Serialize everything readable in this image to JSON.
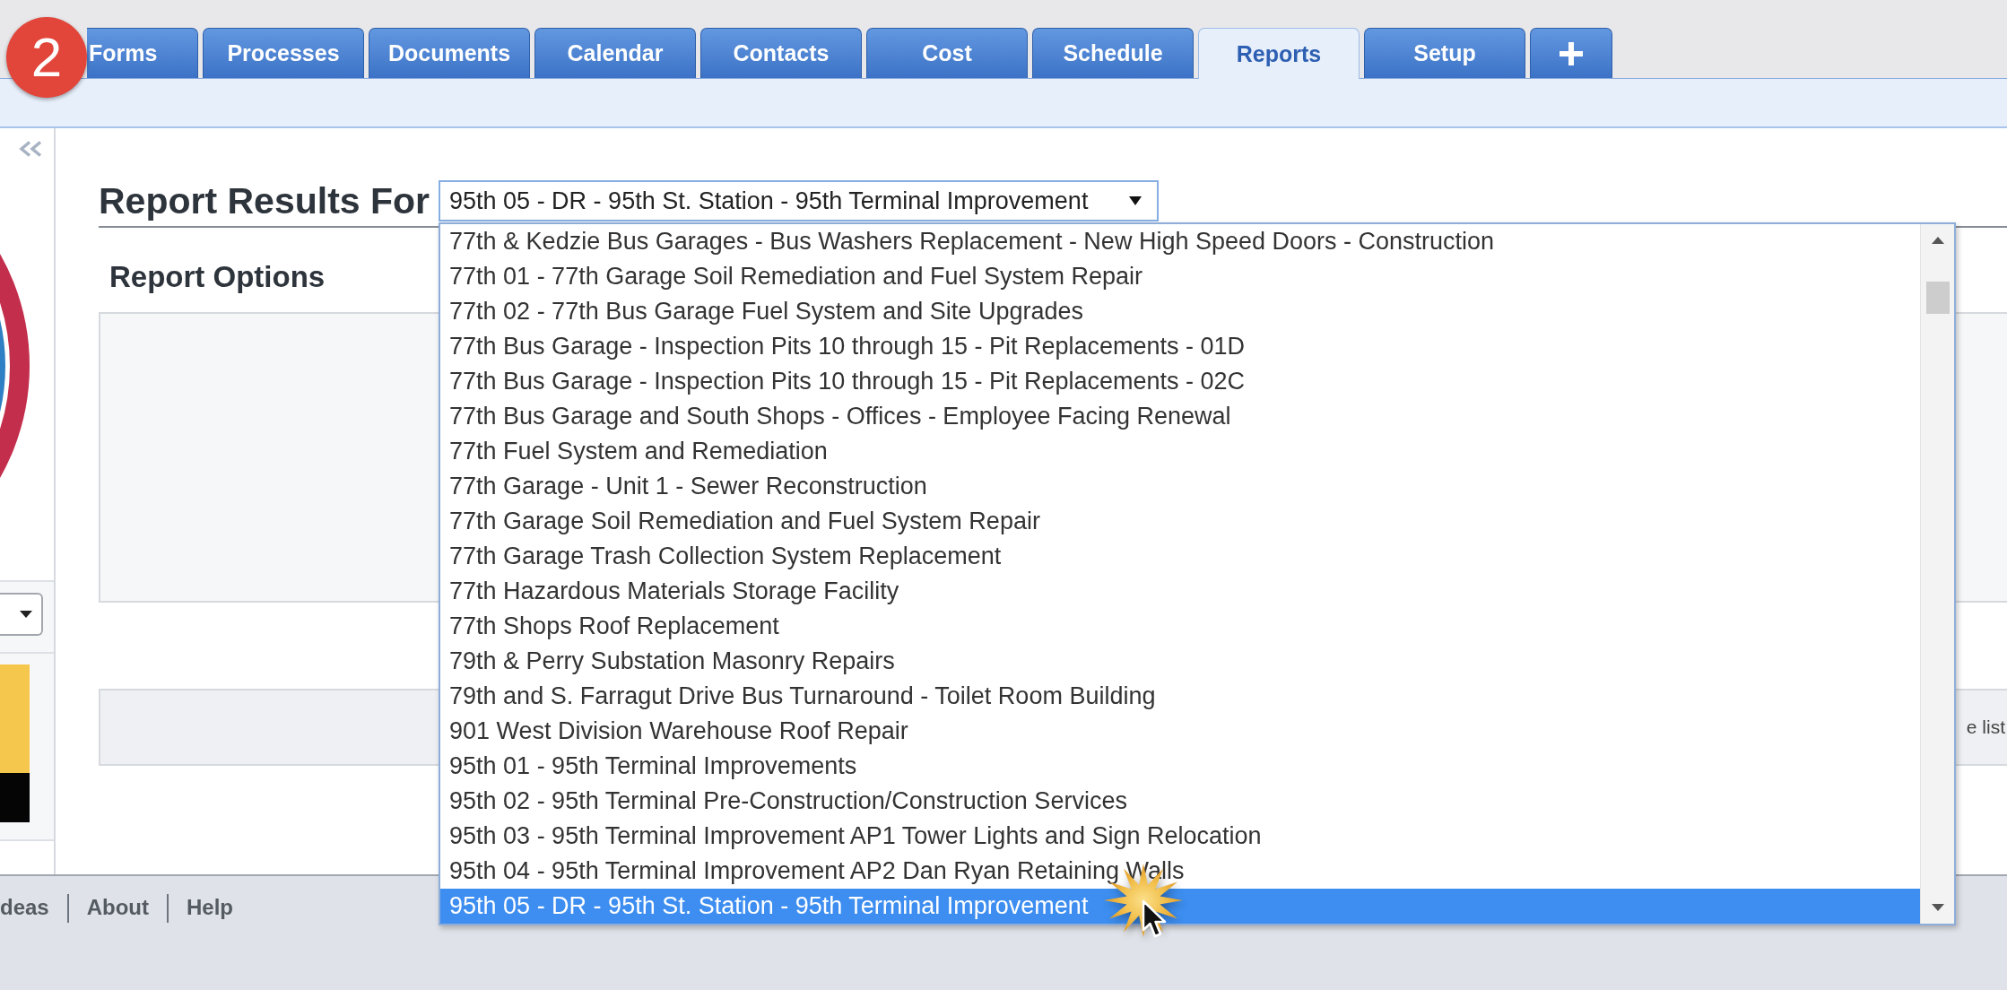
{
  "badge": "2",
  "tabs": [
    {
      "label": "Forms",
      "selected": false
    },
    {
      "label": "Processes",
      "selected": false
    },
    {
      "label": "Documents",
      "selected": false
    },
    {
      "label": "Calendar",
      "selected": false
    },
    {
      "label": "Contacts",
      "selected": false
    },
    {
      "label": "Cost",
      "selected": false
    },
    {
      "label": "Schedule",
      "selected": false
    },
    {
      "label": "Reports",
      "selected": true
    },
    {
      "label": "Setup",
      "selected": false
    }
  ],
  "report": {
    "heading": "Report Results For",
    "project_select": {
      "value": "95th 05 - DR - 95th St. Station - 95th Terminal Improvement",
      "expanded": true
    },
    "options_heading": "Report Options",
    "bar_text": "e list"
  },
  "dropdown_options": [
    {
      "label": "77th & Kedzie Bus Garages - Bus Washers Replacement - New High Speed Doors - Construction",
      "selected": false
    },
    {
      "label": "77th 01 - 77th Garage Soil Remediation and Fuel System Repair",
      "selected": false
    },
    {
      "label": "77th 02 - 77th Bus Garage Fuel System and Site Upgrades",
      "selected": false
    },
    {
      "label": "77th Bus Garage - Inspection Pits 10 through 15 - Pit Replacements - 01D",
      "selected": false
    },
    {
      "label": "77th Bus Garage - Inspection Pits 10 through 15 - Pit Replacements - 02C",
      "selected": false
    },
    {
      "label": "77th Bus Garage and South Shops - Offices - Employee Facing Renewal",
      "selected": false
    },
    {
      "label": "77th Fuel System and Remediation",
      "selected": false
    },
    {
      "label": "77th Garage - Unit 1 - Sewer Reconstruction",
      "selected": false
    },
    {
      "label": "77th Garage Soil Remediation and Fuel System Repair",
      "selected": false
    },
    {
      "label": "77th Garage Trash Collection System Replacement",
      "selected": false
    },
    {
      "label": "77th Hazardous Materials Storage Facility",
      "selected": false
    },
    {
      "label": "77th Shops Roof Replacement",
      "selected": false
    },
    {
      "label": "79th & Perry Substation Masonry Repairs",
      "selected": false
    },
    {
      "label": "79th and S. Farragut Drive Bus Turnaround - Toilet Room Building",
      "selected": false
    },
    {
      "label": "901 West Division Warehouse Roof Repair",
      "selected": false
    },
    {
      "label": "95th 01 - 95th Terminal Improvements",
      "selected": false
    },
    {
      "label": "95th 02 - 95th Terminal Pre-Construction/Construction Services",
      "selected": false
    },
    {
      "label": "95th 03 - 95th Terminal Improvement AP1 Tower Lights and Sign Relocation",
      "selected": false
    },
    {
      "label": "95th 04 - 95th Terminal Improvement AP2 Dan Ryan Retaining Walls",
      "selected": false
    },
    {
      "label": "95th 05 - DR - 95th St. Station - 95th Terminal Improvement",
      "selected": true
    }
  ],
  "footer_links": [
    "deas",
    "About",
    "Help"
  ]
}
